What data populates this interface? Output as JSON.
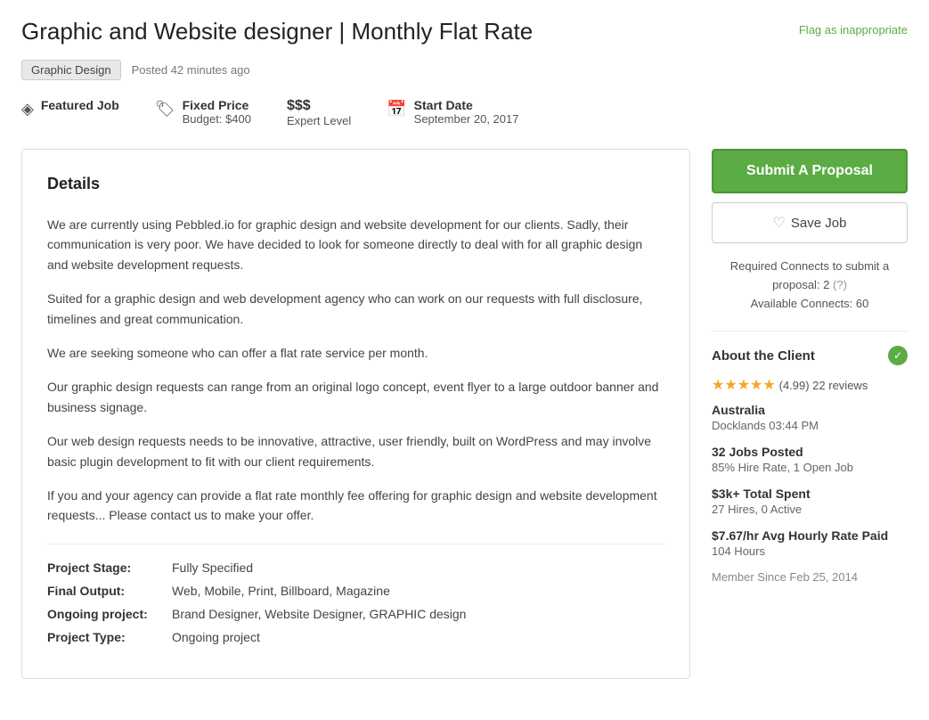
{
  "page": {
    "flag_link": "Flag as inappropriate",
    "job_title": "Graphic and Website designer | Monthly Flat Rate",
    "tag": "Graphic Design",
    "posted": "Posted 42 minutes ago",
    "featured_job_label": "Featured Job",
    "fixed_price_label": "Fixed Price",
    "budget_label": "Budget: $400",
    "dollar_signs": "$$$",
    "expert_level": "Expert Level",
    "start_date_label": "Start Date",
    "start_date_value": "September 20, 2017",
    "details_heading": "Details",
    "para1": "We are currently using Pebbled.io for graphic design and website development for our clients.  Sadly, their communication is very poor.  We have decided to look for someone directly to deal with for all graphic design and website development requests.",
    "para2": "Suited for a graphic design and web development agency who can work on our requests with full disclosure, timelines and great communication.",
    "para3": "We are seeking someone who can offer a flat rate service per month.",
    "para4": "Our graphic design requests can range from an original logo concept, event flyer to a large outdoor banner and business signage.",
    "para5": "Our web design requests needs to be innovative, attractive, user friendly, built on WordPress and may involve basic plugin development to fit with our client requirements.",
    "para6": "If you and your agency can provide a flat rate monthly fee offering for graphic design and website development requests... Please contact us to make your offer.",
    "project_stage_label": "Project Stage:",
    "project_stage_value": "Fully Specified",
    "final_output_label": "Final Output:",
    "final_output_value": "Web, Mobile, Print, Billboard, Magazine",
    "ongoing_project_label": "Ongoing project:",
    "ongoing_project_value": "Brand Designer, Website Designer, GRAPHIC design",
    "project_type_label": "Project Type:",
    "project_type_value": "Ongoing project"
  },
  "sidebar": {
    "submit_btn": "Submit A Proposal",
    "save_btn": "Save Job",
    "connects_text": "Required Connects to submit a proposal: 2",
    "available_connects": "Available Connects: 60",
    "about_client_title": "About the Client",
    "rating": "(4.99) 22 reviews",
    "location": "Australia",
    "location_sub": "Docklands 03:44 PM",
    "jobs_posted_label": "32 Jobs Posted",
    "jobs_posted_sub": "85% Hire Rate, 1 Open Job",
    "total_spent_label": "$3k+ Total Spent",
    "total_spent_sub": "27 Hires, 0 Active",
    "avg_rate_label": "$7.67/hr Avg Hourly Rate Paid",
    "avg_rate_sub": "104 Hours",
    "member_since": "Member Since Feb 25, 2014"
  }
}
